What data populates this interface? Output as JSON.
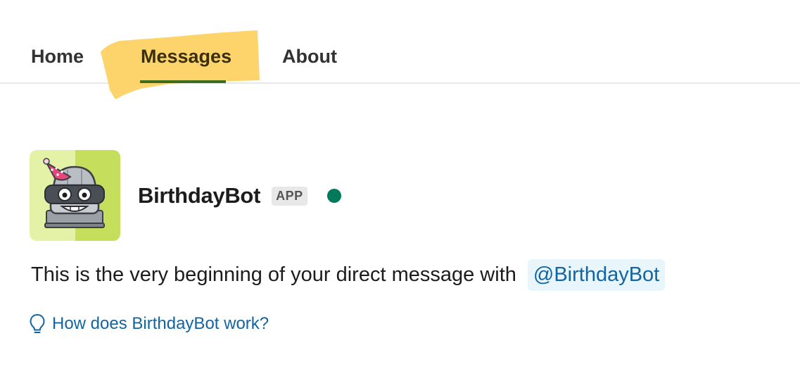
{
  "tabs": {
    "home": "Home",
    "messages": "Messages",
    "about": "About",
    "active": "messages"
  },
  "bot": {
    "name": "BirthdayBot",
    "badge": "APP",
    "status": "online",
    "avatar_icon": "robot-party-hat-icon"
  },
  "intro": {
    "text": "This is the very beginning of your direct message with",
    "mention": "@BirthdayBot"
  },
  "help": {
    "icon": "lightbulb-icon",
    "link": "How does BirthdayBot work?"
  },
  "colors": {
    "highlight": "#fdd36b",
    "tab_underline": "#3e6b1c",
    "status_online": "#007a5a",
    "link": "#1264a3",
    "mention_bg": "#e8f5fa",
    "avatar_bg_light": "#e3f2a7",
    "avatar_bg_dark": "#c5df5c"
  }
}
